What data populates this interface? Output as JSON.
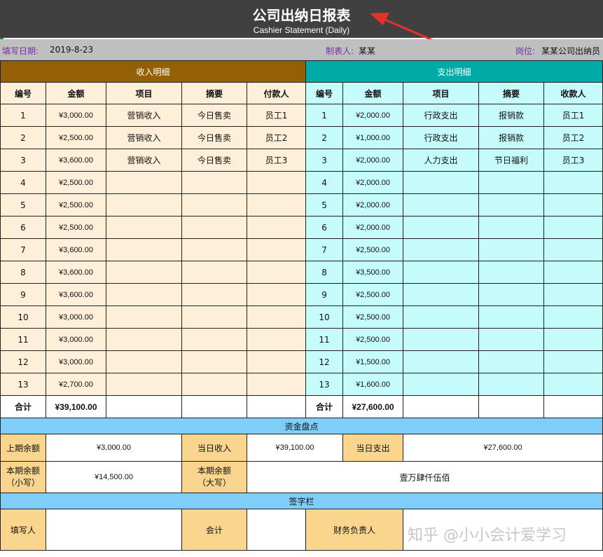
{
  "header": {
    "title": "公司出纳日报表",
    "subtitle": "Cashier Statement (Daily)"
  },
  "info": {
    "date_label": "填写日期:",
    "date_value": "2019-8-23",
    "preparer_label": "制表人:",
    "preparer_value": "某某",
    "post_label": "岗位:",
    "post_value": "某某公司出纳员"
  },
  "income": {
    "section_title": "收入明细",
    "columns": [
      "编号",
      "金额",
      "项目",
      "摘要",
      "付款人"
    ],
    "rows": [
      {
        "no": "1",
        "amount": "¥3,000.00",
        "item": "营销收入",
        "summary": "今日售卖",
        "payer": "员工1"
      },
      {
        "no": "2",
        "amount": "¥2,500.00",
        "item": "营销收入",
        "summary": "今日售卖",
        "payer": "员工2"
      },
      {
        "no": "3",
        "amount": "¥3,600.00",
        "item": "营销收入",
        "summary": "今日售卖",
        "payer": "员工3"
      },
      {
        "no": "4",
        "amount": "¥2,500.00",
        "item": "",
        "summary": "",
        "payer": ""
      },
      {
        "no": "5",
        "amount": "¥2,500.00",
        "item": "",
        "summary": "",
        "payer": ""
      },
      {
        "no": "6",
        "amount": "¥2,500.00",
        "item": "",
        "summary": "",
        "payer": ""
      },
      {
        "no": "7",
        "amount": "¥3,600.00",
        "item": "",
        "summary": "",
        "payer": ""
      },
      {
        "no": "8",
        "amount": "¥3,600.00",
        "item": "",
        "summary": "",
        "payer": ""
      },
      {
        "no": "9",
        "amount": "¥3,600.00",
        "item": "",
        "summary": "",
        "payer": ""
      },
      {
        "no": "10",
        "amount": "¥3,000.00",
        "item": "",
        "summary": "",
        "payer": ""
      },
      {
        "no": "11",
        "amount": "¥3,000.00",
        "item": "",
        "summary": "",
        "payer": ""
      },
      {
        "no": "12",
        "amount": "¥3,000.00",
        "item": "",
        "summary": "",
        "payer": ""
      },
      {
        "no": "13",
        "amount": "¥2,700.00",
        "item": "",
        "summary": "",
        "payer": ""
      }
    ],
    "total_label": "合计",
    "total_value": "¥39,100.00"
  },
  "expense": {
    "section_title": "支出明细",
    "columns": [
      "编号",
      "金额",
      "项目",
      "摘要",
      "收款人"
    ],
    "rows": [
      {
        "no": "1",
        "amount": "¥2,000.00",
        "item": "行政支出",
        "summary": "报销款",
        "payee": "员工1"
      },
      {
        "no": "2",
        "amount": "¥1,000.00",
        "item": "行政支出",
        "summary": "报销款",
        "payee": "员工2"
      },
      {
        "no": "3",
        "amount": "¥2,000.00",
        "item": "人力支出",
        "summary": "节日福利",
        "payee": "员工3"
      },
      {
        "no": "4",
        "amount": "¥2,000.00",
        "item": "",
        "summary": "",
        "payee": ""
      },
      {
        "no": "5",
        "amount": "¥2,000.00",
        "item": "",
        "summary": "",
        "payee": ""
      },
      {
        "no": "6",
        "amount": "¥2,000.00",
        "item": "",
        "summary": "",
        "payee": ""
      },
      {
        "no": "7",
        "amount": "¥2,500.00",
        "item": "",
        "summary": "",
        "payee": ""
      },
      {
        "no": "8",
        "amount": "¥3,500.00",
        "item": "",
        "summary": "",
        "payee": ""
      },
      {
        "no": "9",
        "amount": "¥2,500.00",
        "item": "",
        "summary": "",
        "payee": ""
      },
      {
        "no": "10",
        "amount": "¥2,500.00",
        "item": "",
        "summary": "",
        "payee": ""
      },
      {
        "no": "11",
        "amount": "¥2,500.00",
        "item": "",
        "summary": "",
        "payee": ""
      },
      {
        "no": "12",
        "amount": "¥1,500.00",
        "item": "",
        "summary": "",
        "payee": ""
      },
      {
        "no": "13",
        "amount": "¥1,600.00",
        "item": "",
        "summary": "",
        "payee": ""
      }
    ],
    "total_label": "合计",
    "total_value": "¥27,600.00"
  },
  "funds": {
    "section_title": "资金盘点",
    "prev_balance_label": "上期余额",
    "prev_balance_value": "¥3,000.00",
    "today_income_label": "当日收入",
    "today_income_value": "¥39,100.00",
    "today_expense_label": "当日支出",
    "today_expense_value": "¥27,600.00",
    "cur_balance_small_label_1": "本期余额",
    "cur_balance_small_label_2": "（小写）",
    "cur_balance_small_value": "¥14,500.00",
    "cur_balance_big_label_1": "本期余额",
    "cur_balance_big_label_2": "（大写）",
    "cur_balance_big_value": "壹万肆仟伍佰"
  },
  "signature": {
    "section_title": "签字栏",
    "filler_label": "填写人",
    "accountant_label": "会计",
    "finance_head_label": "财务负责人"
  },
  "watermark": "知乎 @小小会计爱学习",
  "colors": {
    "title_bg": "#404040",
    "info_bg": "#bfbfbf",
    "income_header": "#946005",
    "income_fill": "#fdefd8",
    "expense_header": "#00aaa6",
    "expense_fill": "#c6fbfb",
    "band": "#7fcefa",
    "gold": "#f9d58e",
    "arrow": "#e8302a"
  }
}
